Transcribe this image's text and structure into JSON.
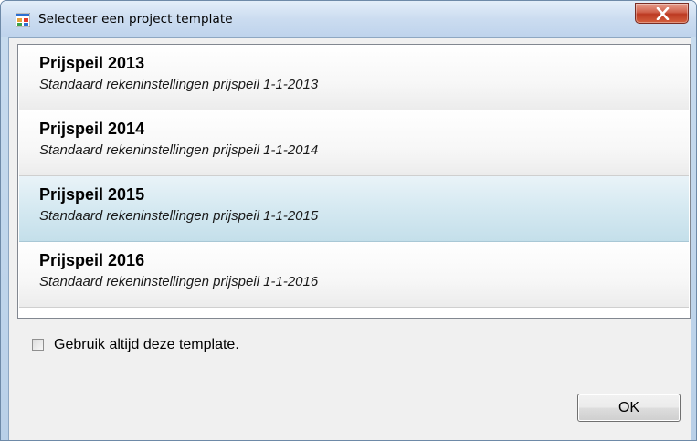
{
  "window": {
    "title": "Selecteer een project template",
    "close_label": "close"
  },
  "templates": [
    {
      "title": "Prijspeil 2013",
      "subtitle": "Standaard rekeninstellingen prijspeil 1-1-2013",
      "selected": false
    },
    {
      "title": "Prijspeil 2014",
      "subtitle": "Standaard rekeninstellingen prijspeil 1-1-2014",
      "selected": false
    },
    {
      "title": "Prijspeil 2015",
      "subtitle": "Standaard rekeninstellingen prijspeil 1-1-2015",
      "selected": true
    },
    {
      "title": "Prijspeil 2016",
      "subtitle": "Standaard rekeninstellingen prijspeil 1-1-2016",
      "selected": false
    }
  ],
  "options": {
    "always_use_label": "Gebruik altijd deze template.",
    "always_use_checked": false
  },
  "buttons": {
    "ok_label": "OK"
  },
  "icons": {
    "app": "app-window-icon",
    "close": "close-icon"
  },
  "colors": {
    "selection": "#c4dfea",
    "close_button": "#c84a33"
  }
}
